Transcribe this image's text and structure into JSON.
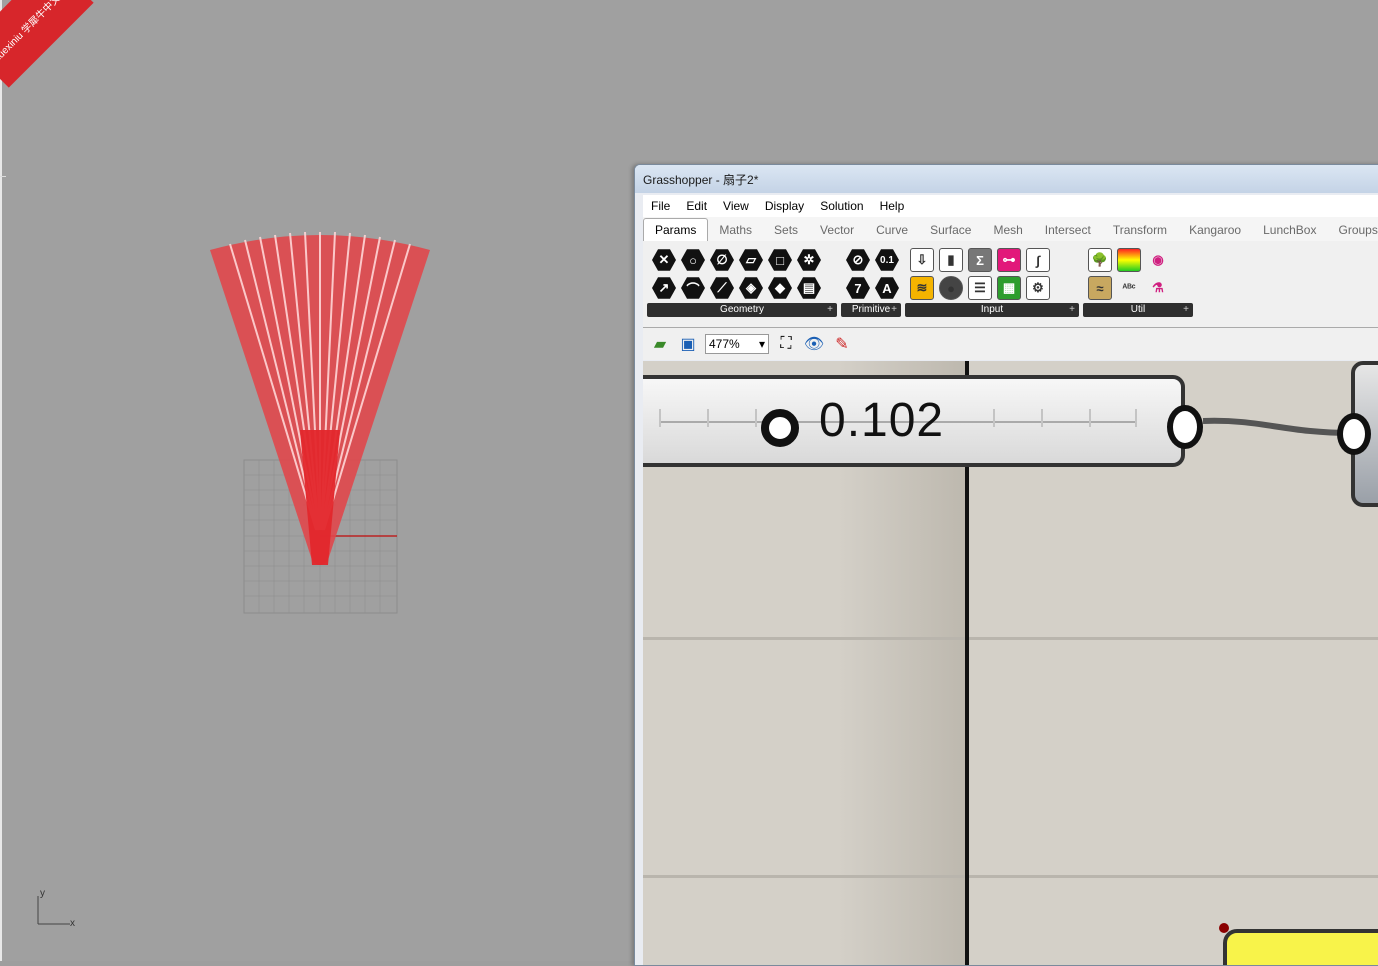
{
  "watermark": {
    "text": "xuexiniu 学犀牛中文网"
  },
  "viewport": {
    "axis_y": "y",
    "axis_x": "x"
  },
  "window": {
    "title": "Grasshopper - 扇子2*"
  },
  "menu": [
    "File",
    "Edit",
    "View",
    "Display",
    "Solution",
    "Help"
  ],
  "tabs": [
    {
      "label": "Params",
      "active": true
    },
    {
      "label": "Maths"
    },
    {
      "label": "Sets"
    },
    {
      "label": "Vector"
    },
    {
      "label": "Curve"
    },
    {
      "label": "Surface"
    },
    {
      "label": "Mesh"
    },
    {
      "label": "Intersect"
    },
    {
      "label": "Transform"
    },
    {
      "label": "Kangaroo"
    },
    {
      "label": "LunchBox"
    },
    {
      "label": "Groups"
    }
  ],
  "ribbon": {
    "geometry": "Geometry",
    "primitive": "Primitive",
    "input": "Input",
    "util": "Util",
    "primitive_icons": [
      "0.1",
      "7",
      "A"
    ]
  },
  "toolbar": {
    "zoom": "477%"
  },
  "canvas": {
    "slider_value": "0.102"
  }
}
